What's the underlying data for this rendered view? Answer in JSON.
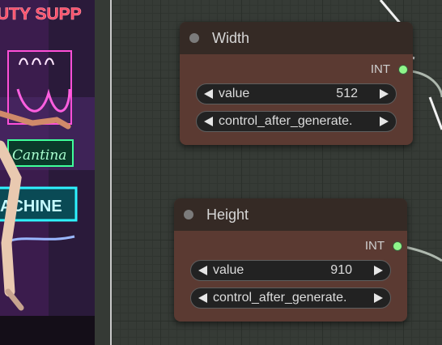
{
  "preview": {
    "neon_signs": [
      "UTY SUPP",
      "Cantina",
      "ACHINE"
    ]
  },
  "nodes": [
    {
      "title": "Width",
      "output_type": "INT",
      "widgets": [
        {
          "label": "value",
          "value": "512"
        },
        {
          "label": "control_after_generate.",
          "value": ""
        }
      ]
    },
    {
      "title": "Height",
      "output_type": "INT",
      "widgets": [
        {
          "label": "value",
          "value": "910"
        },
        {
          "label": "control_after_generate.",
          "value": ""
        }
      ]
    }
  ],
  "colors": {
    "node_body": "#5b3a32",
    "node_header": "#352a25",
    "output_slot": "#8ff58a",
    "canvas": "#363b36"
  }
}
